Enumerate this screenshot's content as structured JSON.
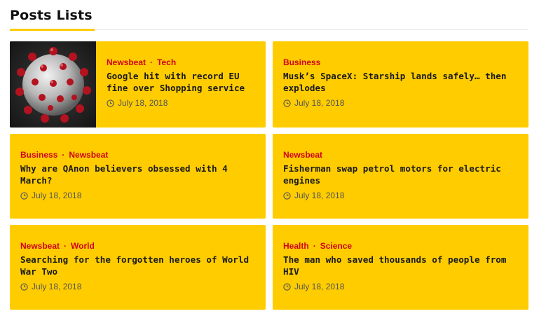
{
  "section": {
    "title": "Posts Lists",
    "accent_color": "#ffcc00"
  },
  "posts": [
    {
      "categories": [
        "Newsbeat",
        "Tech"
      ],
      "title": "Google hit with record EU fine over Shopping service",
      "date": "July 18, 2018",
      "has_thumbnail": true,
      "thumbnail_subject": "virus-illustration"
    },
    {
      "categories": [
        "Business"
      ],
      "title": "Musk’s SpaceX: Starship lands safely… then explodes",
      "date": "July 18, 2018"
    },
    {
      "categories": [
        "Business",
        "Newsbeat"
      ],
      "title": "Why are QAnon believers obsessed with 4 March?",
      "date": "July 18, 2018"
    },
    {
      "categories": [
        "Newsbeat"
      ],
      "title": "Fisherman swap petrol motors for electric engines",
      "date": "July 18, 2018"
    },
    {
      "categories": [
        "Newsbeat",
        "World"
      ],
      "title": "Searching for the forgotten heroes of World War Two",
      "date": "July 18, 2018"
    },
    {
      "categories": [
        "Health",
        "Science"
      ],
      "title": "The man who saved thousands of people from HIV",
      "date": "July 18, 2018"
    }
  ],
  "colors": {
    "card_background": "#ffcc00",
    "category_text": "#d0021b",
    "date_text": "#555555"
  },
  "icons": {
    "date": "clock-icon"
  }
}
